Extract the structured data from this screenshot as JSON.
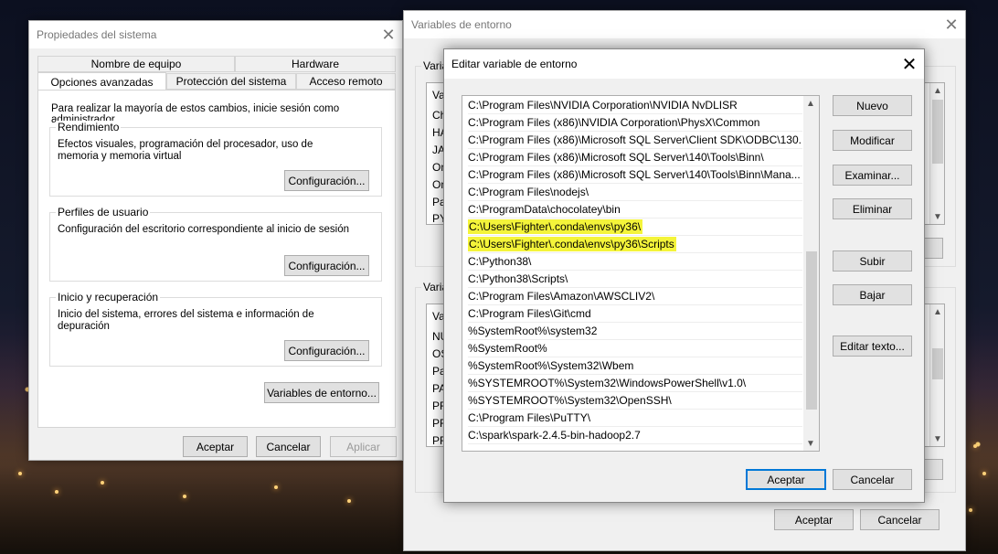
{
  "sysprops": {
    "title": "Propiedades del sistema",
    "tabs_top": [
      "Nombre de equipo",
      "Hardware"
    ],
    "tabs_bottom": [
      "Opciones avanzadas",
      "Protección del sistema",
      "Acceso remoto"
    ],
    "admin_note": "Para realizar la mayoría de estos cambios, inicie sesión como administrador.",
    "groups": [
      {
        "legend": "Rendimiento",
        "text": "Efectos visuales, programación del procesador, uso de memoria y memoria virtual",
        "button": "Configuración..."
      },
      {
        "legend": "Perfiles de usuario",
        "text": "Configuración del escritorio correspondiente al inicio de sesión",
        "button": "Configuración..."
      },
      {
        "legend": "Inicio y recuperación",
        "text": "Inicio del sistema, errores del sistema e información de depuración",
        "button": "Configuración..."
      }
    ],
    "env_button": "Variables de entorno...",
    "ok": "Aceptar",
    "cancel": "Cancelar",
    "apply": "Aplicar"
  },
  "envvars": {
    "title": "Variables de entorno",
    "user_group": "Variab",
    "system_group": "Varia",
    "user_peek": [
      "Va",
      "Ch",
      "HA",
      "JA",
      "On",
      "On",
      "Pa",
      "PY"
    ],
    "system_peek": [
      "Va",
      "NU",
      "OS",
      "Pa",
      "PA",
      "PR",
      "PR",
      "PR"
    ],
    "ok": "Aceptar",
    "cancel": "Cancelar"
  },
  "editvar": {
    "title": "Editar variable de entorno",
    "entries": [
      {
        "text": "C:\\Program Files\\NVIDIA Corporation\\NVIDIA NvDLISR",
        "highlight": false
      },
      {
        "text": "C:\\Program Files (x86)\\NVIDIA Corporation\\PhysX\\Common",
        "highlight": false
      },
      {
        "text": "C:\\Program Files (x86)\\Microsoft SQL Server\\Client SDK\\ODBC\\130...",
        "highlight": false
      },
      {
        "text": "C:\\Program Files (x86)\\Microsoft SQL Server\\140\\Tools\\Binn\\",
        "highlight": false
      },
      {
        "text": "C:\\Program Files (x86)\\Microsoft SQL Server\\140\\Tools\\Binn\\Mana...",
        "highlight": false
      },
      {
        "text": "C:\\Program Files\\nodejs\\",
        "highlight": false
      },
      {
        "text": "C:\\ProgramData\\chocolatey\\bin",
        "highlight": false
      },
      {
        "text": "C:\\Users\\Fighter\\.conda\\envs\\py36\\",
        "highlight": true
      },
      {
        "text": "C:\\Users\\Fighter\\.conda\\envs\\py36\\Scripts",
        "highlight": true
      },
      {
        "text": "C:\\Python38\\",
        "highlight": false
      },
      {
        "text": "C:\\Python38\\Scripts\\",
        "highlight": false
      },
      {
        "text": "C:\\Program Files\\Amazon\\AWSCLIV2\\",
        "highlight": false
      },
      {
        "text": "C:\\Program Files\\Git\\cmd",
        "highlight": false
      },
      {
        "text": "%SystemRoot%\\system32",
        "highlight": false
      },
      {
        "text": "%SystemRoot%",
        "highlight": false
      },
      {
        "text": "%SystemRoot%\\System32\\Wbem",
        "highlight": false
      },
      {
        "text": "%SYSTEMROOT%\\System32\\WindowsPowerShell\\v1.0\\",
        "highlight": false
      },
      {
        "text": "%SYSTEMROOT%\\System32\\OpenSSH\\",
        "highlight": false
      },
      {
        "text": "C:\\Program Files\\PuTTY\\",
        "highlight": false
      },
      {
        "text": "C:\\spark\\spark-2.4.5-bin-hadoop2.7",
        "highlight": false
      }
    ],
    "buttons": {
      "new": "Nuevo",
      "edit": "Modificar",
      "browse": "Examinar...",
      "delete": "Eliminar",
      "up": "Subir",
      "down": "Bajar",
      "edit_text": "Editar texto..."
    },
    "ok": "Aceptar",
    "cancel": "Cancelar"
  },
  "colors": {
    "highlight": "#f4f43a",
    "focus_border": "#0078d7"
  }
}
